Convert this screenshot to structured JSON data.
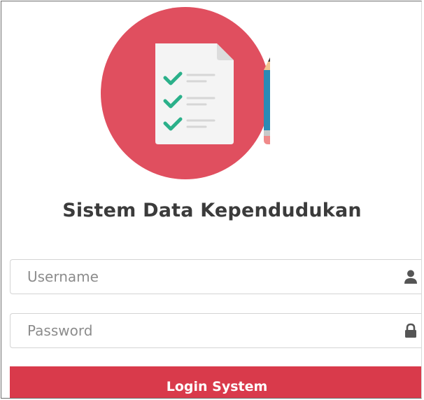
{
  "app": {
    "title": "Sistem Data Kependudukan",
    "logo_icon": "checklist-document-pencil-icon"
  },
  "form": {
    "username_placeholder": "Username",
    "username_value": "",
    "username_icon": "user-icon",
    "password_placeholder": "Password",
    "password_value": "",
    "password_icon": "lock-icon",
    "submit_label": "Login System"
  },
  "colors": {
    "brand": "#d93a4b",
    "logo_circle": "#e04f5f",
    "check": "#2bb08a"
  }
}
